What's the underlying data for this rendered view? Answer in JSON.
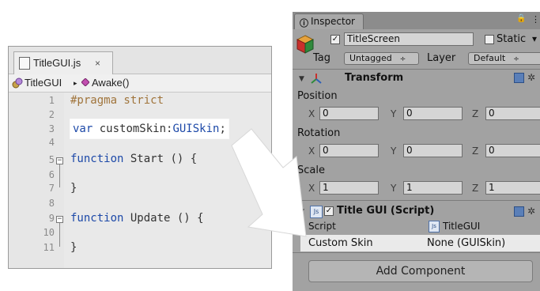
{
  "editor": {
    "tab_label": "TitleGUI.js",
    "tab_close": "×",
    "breadcrumb_1": "TitleGUI",
    "breadcrumb_sep": "▸",
    "breadcrumb_2": "Awake()",
    "line_numbers": [
      "1",
      "2",
      "3",
      "4",
      "5",
      "6",
      "7",
      "8",
      "9",
      "10",
      "11"
    ],
    "fold_open": "−",
    "line1": "#pragma strict",
    "line3_kw": "var",
    "line3_name": " customSkin:",
    "line3_type": "GUISkin",
    "line3_end": ";",
    "line5_kw": "function",
    "line5_rest": " Start () {",
    "line7": "}",
    "line9_kw": "function",
    "line9_rest": " Update () {",
    "line11": "}"
  },
  "inspector": {
    "tab_icon": "ⓘ",
    "tab_label": "Inspector",
    "lock_glyph": "🔒",
    "menu_glyph": "⋮",
    "object_checked": "✓",
    "object_name": "TitleScreen",
    "static_label": "Static",
    "static_caret": "▾",
    "tag_label": "Tag",
    "tag_value": "Untagged",
    "layer_label": "Layer",
    "layer_value": "Default",
    "popup_caret": "÷",
    "transform": {
      "fold": "▼",
      "title": "Transform",
      "position_label": "Position",
      "rotation_label": "Rotation",
      "scale_label": "Scale",
      "x": "X",
      "y": "Y",
      "z": "Z",
      "position": [
        "0",
        "0",
        "0"
      ],
      "rotation": [
        "0",
        "0",
        "0"
      ],
      "scale": [
        "1",
        "1",
        "1"
      ]
    },
    "script": {
      "fold": "▼",
      "checked": "✓",
      "title": "Title GUI (Script)",
      "script_label": "Script",
      "script_value": "TitleGUI",
      "js_badge": "Js",
      "custom_skin_label": "Custom Skin",
      "custom_skin_value": "None (GUISkin)"
    },
    "gear_glyph": "✲",
    "add_component": "Add Component"
  },
  "colors": {
    "keyword": "#1d49a8",
    "pragma": "#a0743b",
    "inspector_bg": "#a2a2a2",
    "arrow": "#ffffff"
  }
}
